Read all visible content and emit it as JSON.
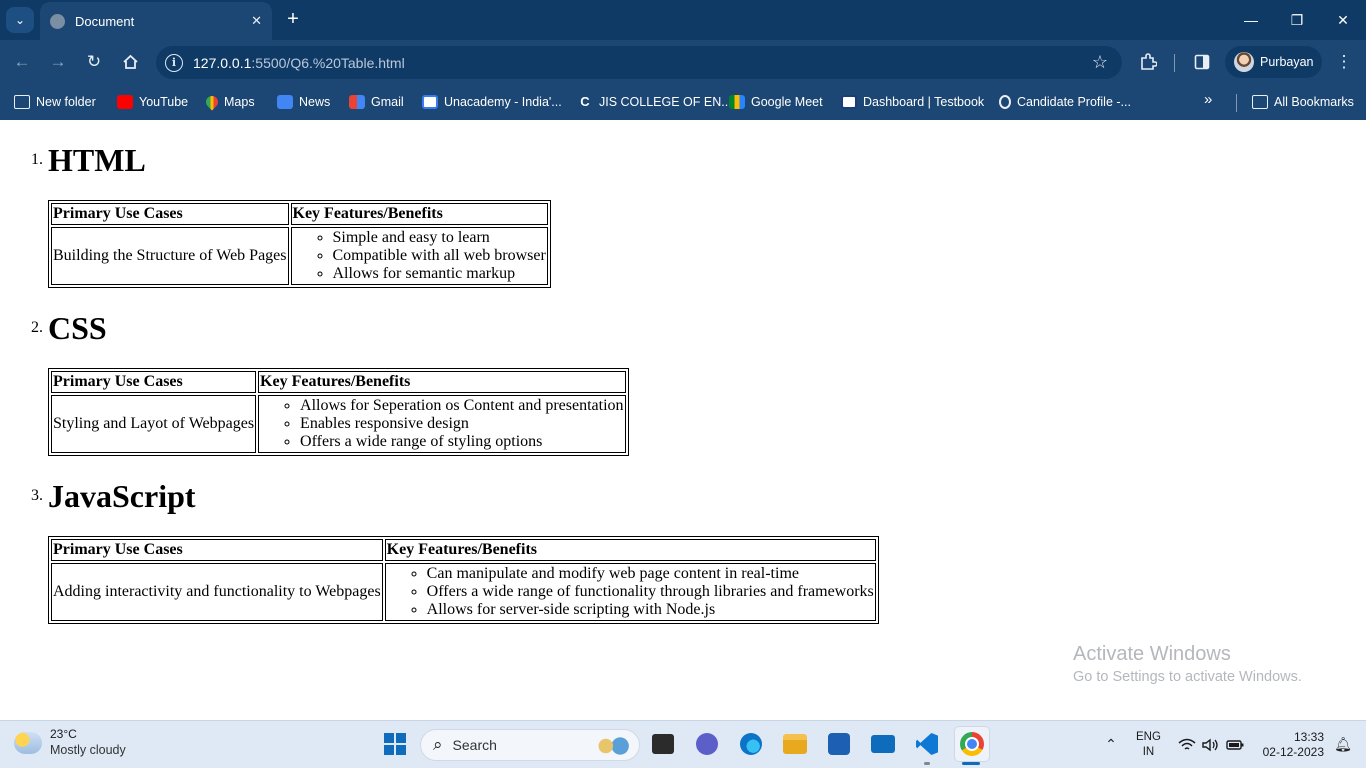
{
  "browser": {
    "tab_title": "Document",
    "tab_close": "✕",
    "new_tab": "+",
    "window_controls": {
      "minimize": "—",
      "restore": "❐",
      "close": "✕"
    },
    "url_host": "127.0.0.1",
    "url_rest": ":5500/Q6.%20Table.html",
    "profile_name": "Purbayan",
    "bookmarks": [
      {
        "label": "New folder",
        "icon": "folder-icon"
      },
      {
        "label": "YouTube",
        "icon": "youtube-icon"
      },
      {
        "label": "Maps",
        "icon": "maps-icon"
      },
      {
        "label": "News",
        "icon": "news-icon"
      },
      {
        "label": "Gmail",
        "icon": "gmail-icon"
      },
      {
        "label": "Unacademy - India'...",
        "icon": "unacademy-icon"
      },
      {
        "label": "JIS COLLEGE OF EN...",
        "icon": "jis-icon"
      },
      {
        "label": "Google Meet",
        "icon": "meet-icon"
      },
      {
        "label": "Dashboard | Testbook",
        "icon": "testbook-icon"
      },
      {
        "label": "Candidate Profile -...",
        "icon": "candidate-icon"
      }
    ],
    "more_bookmarks": "»",
    "all_bookmarks": "All Bookmarks"
  },
  "page": {
    "sections": [
      {
        "marker": "1.",
        "heading": "HTML",
        "col1_header": "Primary Use Cases",
        "col2_header": "Key Features/Benefits",
        "use_case": "Building the Structure of Web Pages",
        "features": [
          "Simple and easy to learn",
          "Compatible with all web browser",
          "Allows for semantic markup"
        ]
      },
      {
        "marker": "2.",
        "heading": "CSS",
        "col1_header": "Primary Use Cases",
        "col2_header": "Key Features/Benefits",
        "use_case": "Styling and Layot of Webpages",
        "features": [
          "Allows for Seperation os Content and presentation",
          "Enables responsive design",
          "Offers a wide range of styling options"
        ]
      },
      {
        "marker": "3.",
        "heading": "JavaScript",
        "col1_header": "Primary Use Cases",
        "col2_header": "Key Features/Benefits",
        "use_case": "Adding interactivity and functionality to Webpages",
        "features": [
          "Can manipulate and modify web page content in real-time",
          "Offers a wide range of functionality through libraries and frameworks",
          "Allows for server-side scripting with Node.js"
        ]
      }
    ]
  },
  "watermark": {
    "line1": "Activate Windows",
    "line2": "Go to Settings to activate Windows."
  },
  "taskbar": {
    "weather_temp": "23°C",
    "weather_cond": "Mostly cloudy",
    "search_placeholder": "Search",
    "lang_line1": "ENG",
    "lang_line2": "IN",
    "time": "13:33",
    "date": "02-12-2023"
  },
  "colors": {
    "titlebar": "#0f3a66",
    "toolbar": "#1c4673",
    "taskbar": "#dfe9f5"
  }
}
